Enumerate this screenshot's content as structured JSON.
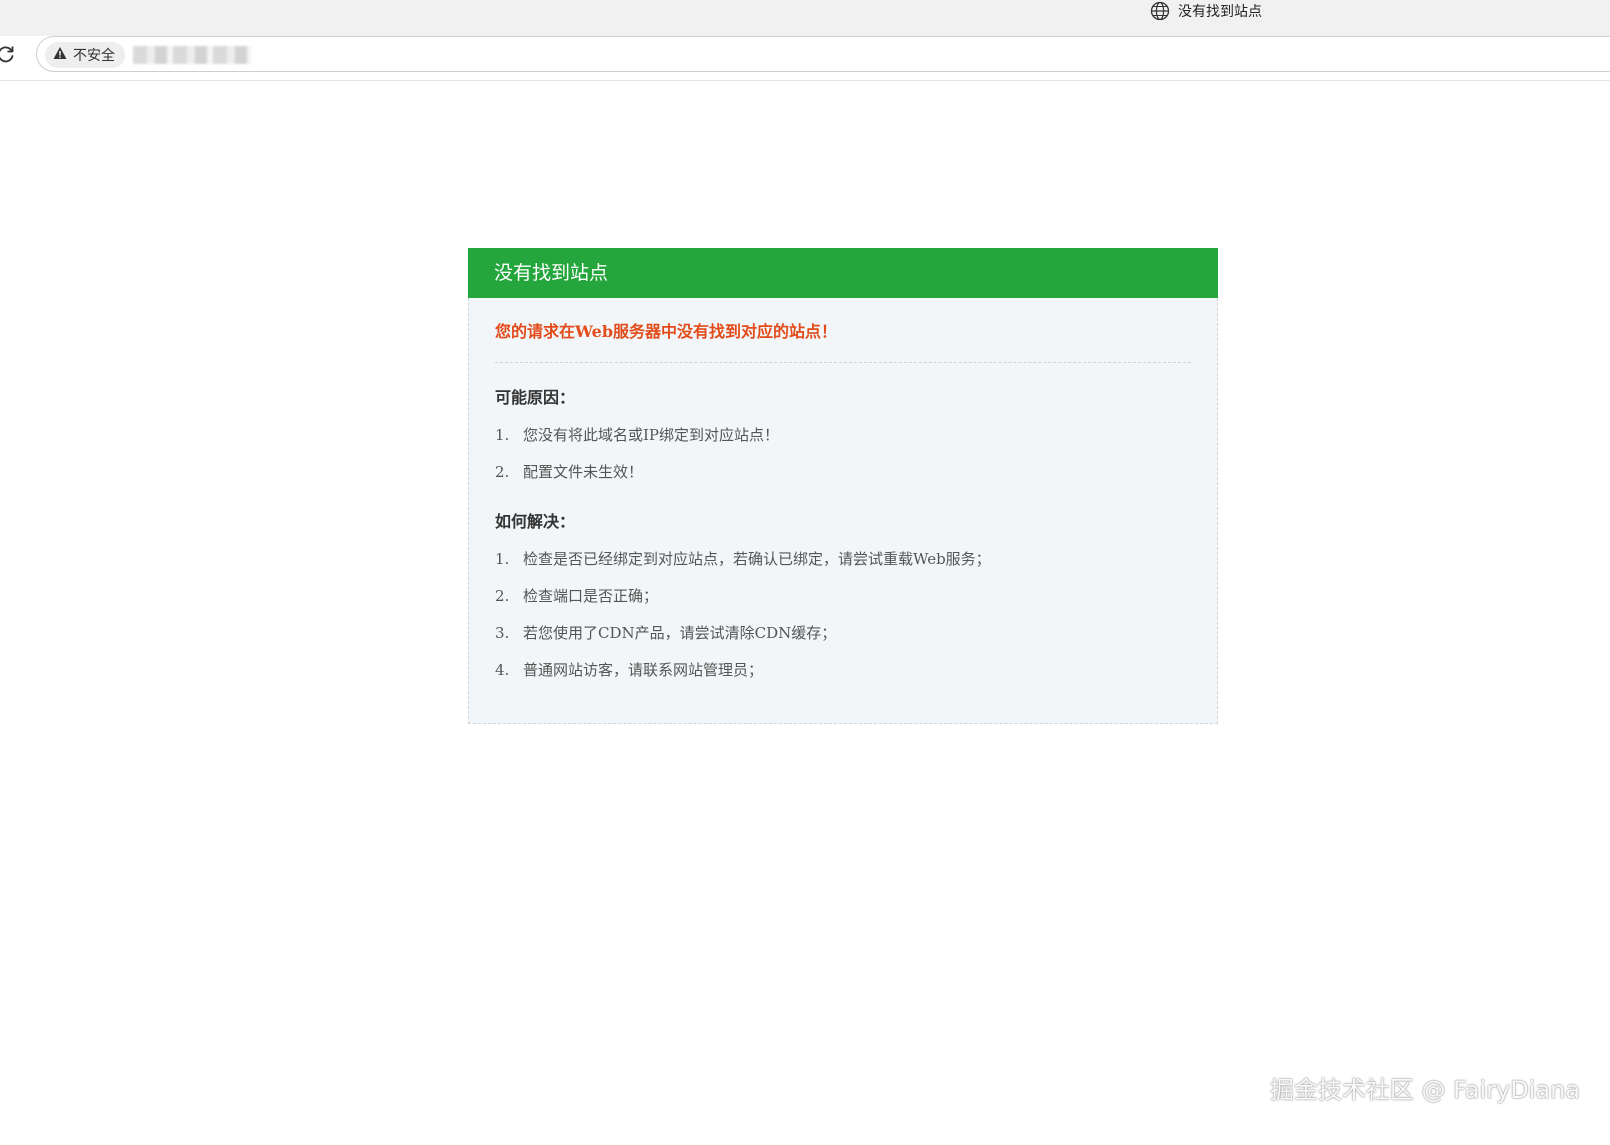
{
  "browser": {
    "tab": {
      "title": "没有找到站点",
      "icon": "globe-icon"
    },
    "address_bar": {
      "security_label": "不安全",
      "url": "•"
    }
  },
  "error_card": {
    "header_title": "没有找到站点",
    "alert": "您的请求在Web服务器中没有找到对应的站点！",
    "reasons": {
      "title": "可能原因：",
      "items": [
        {
          "num": "1.",
          "text": "您没有将此域名或IP绑定到对应站点！"
        },
        {
          "num": "2.",
          "text": "配置文件未生效！"
        }
      ]
    },
    "solutions": {
      "title": "如何解决：",
      "items": [
        {
          "num": "1.",
          "text": "检查是否已经绑定到对应站点，若确认已绑定，请尝试重载Web服务；"
        },
        {
          "num": "2.",
          "text": "检查端口是否正确；"
        },
        {
          "num": "3.",
          "text": "若您使用了CDN产品，请尝试清除CDN缓存；"
        },
        {
          "num": "4.",
          "text": "普通网站访客，请联系网站管理员；"
        }
      ]
    }
  },
  "watermark": "掘金技术社区 @ FairyDiana",
  "colors": {
    "header_green": "#24a63c",
    "alert_orange": "#e24c1b",
    "card_bg": "#f2f6f8"
  }
}
